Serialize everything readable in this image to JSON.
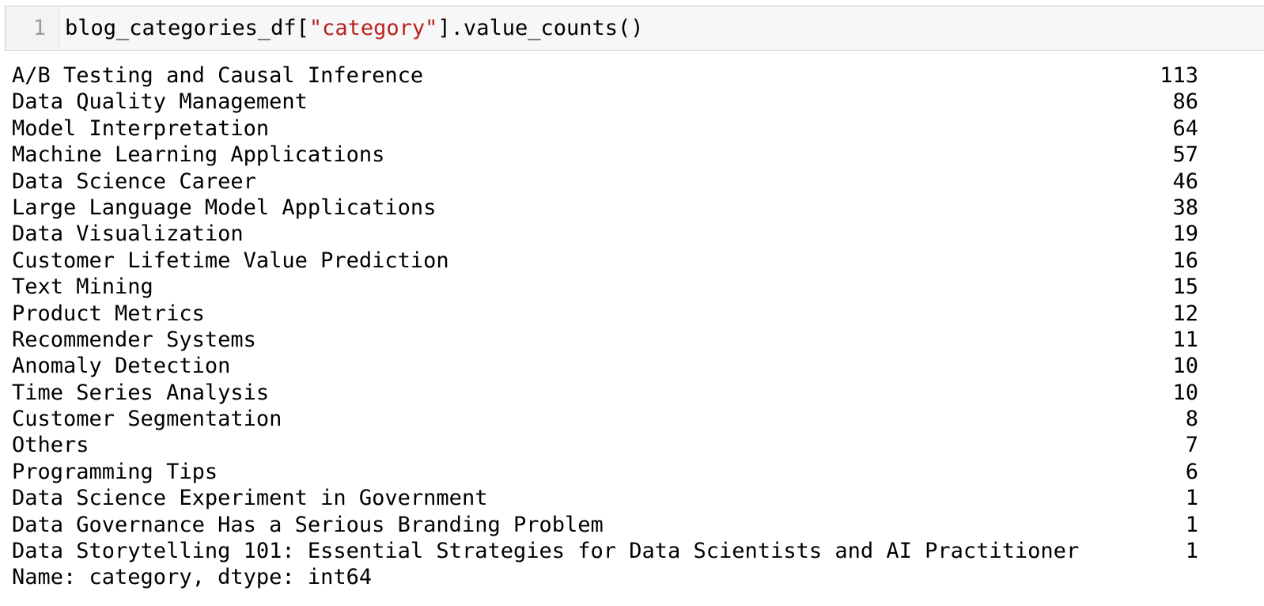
{
  "cell": {
    "line_number": "1",
    "code_prefix": "blog_categories_df[",
    "code_string": "\"category\"",
    "code_suffix": "].value_counts()"
  },
  "output": {
    "rows": [
      {
        "label": "A/B Testing and Causal Inference",
        "count": "113"
      },
      {
        "label": "Data Quality Management",
        "count": "86"
      },
      {
        "label": "Model Interpretation",
        "count": "64"
      },
      {
        "label": "Machine Learning Applications",
        "count": "57"
      },
      {
        "label": "Data Science Career",
        "count": "46"
      },
      {
        "label": "Large Language Model Applications",
        "count": "38"
      },
      {
        "label": "Data Visualization",
        "count": "19"
      },
      {
        "label": "Customer Lifetime Value Prediction",
        "count": "16"
      },
      {
        "label": "Text Mining",
        "count": "15"
      },
      {
        "label": "Product Metrics",
        "count": "12"
      },
      {
        "label": "Recommender Systems",
        "count": "11"
      },
      {
        "label": "Anomaly Detection",
        "count": "10"
      },
      {
        "label": "Time Series Analysis",
        "count": "10"
      },
      {
        "label": "Customer Segmentation",
        "count": "8"
      },
      {
        "label": "Others",
        "count": "7"
      },
      {
        "label": "Programming Tips",
        "count": "6"
      },
      {
        "label": "Data Science Experiment in Government",
        "count": "1"
      },
      {
        "label": "Data Governance Has a Serious Branding Problem",
        "count": "1"
      },
      {
        "label": "Data Storytelling 101: Essential Strategies for Data Scientists and AI Practitioner",
        "count": "1"
      }
    ],
    "footer": "Name: category, dtype: int64"
  },
  "colors": {
    "string_literal": "#ba2121",
    "cell_background": "#f7f7f7",
    "cell_border": "#cfcfcf",
    "line_number": "#999999"
  }
}
